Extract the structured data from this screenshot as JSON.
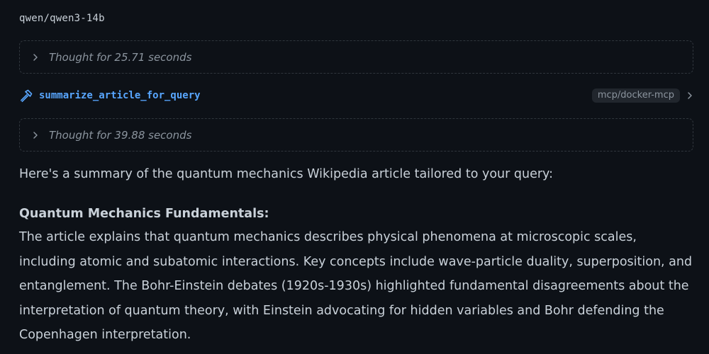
{
  "model": {
    "name": "qwen/qwen3-14b"
  },
  "thoughts": [
    {
      "label": "Thought for 25.71 seconds"
    },
    {
      "label": "Thought for 39.88 seconds"
    }
  ],
  "tool_call": {
    "name": "summarize_article_for_query",
    "badge": "mcp/docker-mcp",
    "icon": "hammer-icon"
  },
  "answer": {
    "intro": "Here's a summary of the quantum mechanics Wikipedia article tailored to your query:",
    "heading": "Quantum Mechanics Fundamentals:",
    "body": "The article explains that quantum mechanics describes physical phenomena at microscopic scales, including atomic and subatomic interactions. Key concepts include wave-particle duality, superposition, and entanglement. The Bohr-Einstein debates (1920s-1930s) highlighted fundamental disagreements about the interpretation of quantum theory, with Einstein advocating for hidden variables and Bohr defending the Copenhagen interpretation."
  },
  "colors": {
    "background": "#0d1117",
    "text": "#c9d1d9",
    "muted": "#8b949e",
    "accent": "#58a6ff",
    "border": "#30363d"
  }
}
